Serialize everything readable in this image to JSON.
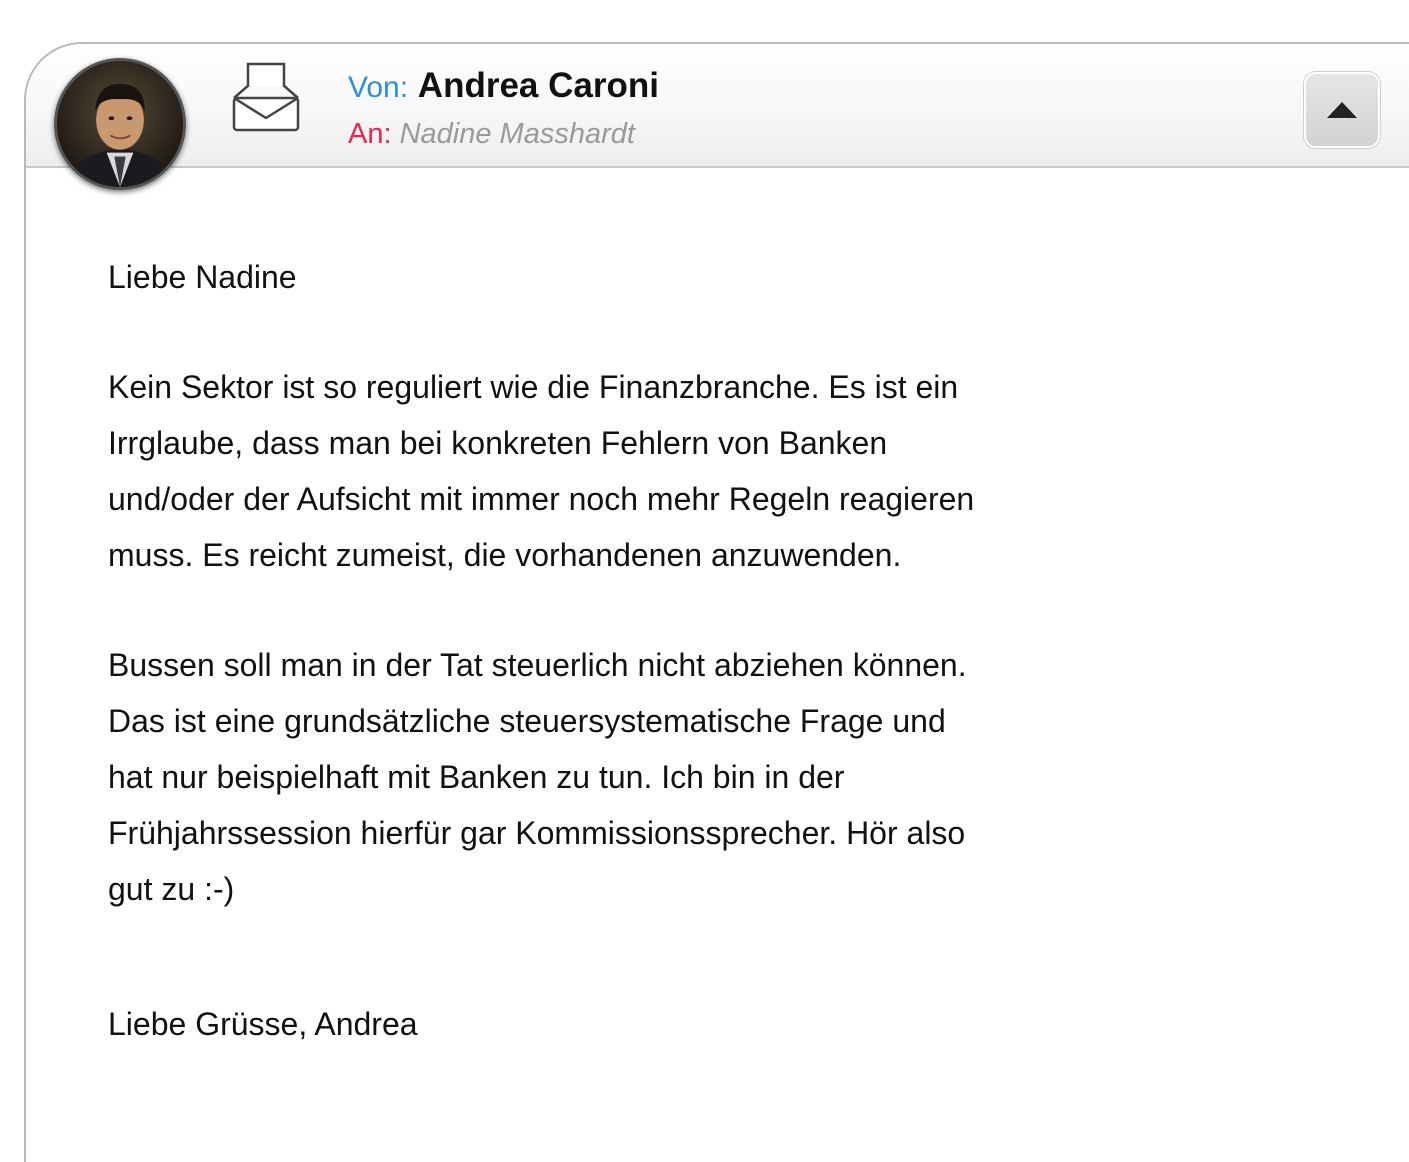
{
  "message": {
    "from_label": "Von:",
    "from_name": "Andrea Caroni",
    "to_label": "An:",
    "to_name": "Nadine Masshardt"
  },
  "icons": {
    "avatar": "avatar-photo",
    "envelope": "envelope-open-icon",
    "collapse": "triangle-up-icon"
  },
  "colors": {
    "from_label": "#2e8fd3",
    "to_label": "#e8264f",
    "to_name": "#9a9a9a"
  },
  "body": {
    "greeting": "Liebe Nadine",
    "paragraph1": {
      "line1": "Kein Sektor ist so reguliert wie die Finanzbranche. Es ist ein",
      "line2": "Irrglaube, dass man bei konkreten Fehlern von Banken",
      "line3": "und/oder der Aufsicht mit immer noch mehr Regeln reagieren",
      "line4": "muss. Es reicht zumeist, die vorhandenen anzuwenden."
    },
    "paragraph2": {
      "line1": "Bussen soll man in der Tat steuerlich nicht abziehen können.",
      "line2": "Das ist eine grundsätzliche steuersystematische Frage und",
      "line3": "hat nur beispielhaft mit Banken zu tun. Ich bin in der",
      "line4": "Frühjahrssession hierfür gar Kommissionssprecher. Hör also",
      "line5": "gut zu :-)"
    },
    "closing": "Liebe Grüsse, Andrea"
  }
}
